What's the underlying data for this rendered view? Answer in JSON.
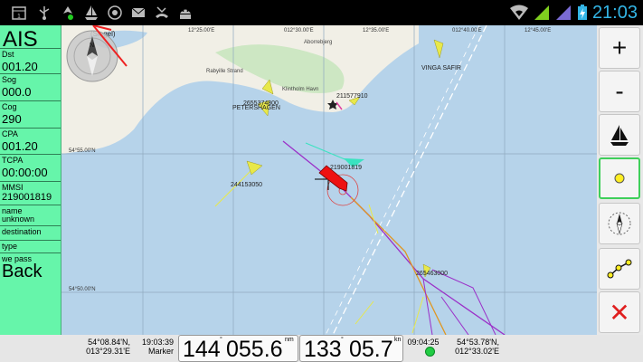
{
  "status_bar": {
    "time": "21:03",
    "icons": [
      "calendar-icon",
      "usb-icon",
      "nav-icon",
      "sailboat-icon",
      "disc-icon",
      "mail-icon",
      "missed-call-icon",
      "android-icon",
      "wifi-icon",
      "signal-icon",
      "signal-icon",
      "battery-charging-icon"
    ]
  },
  "left_panel": {
    "title": "AIS",
    "fields": [
      {
        "label": "Dst",
        "value": "001.20"
      },
      {
        "label": "Sog",
        "value": "000.0"
      },
      {
        "label": "Cog",
        "value": "290"
      },
      {
        "label": "CPA",
        "value": "001.20"
      },
      {
        "label": "TCPA",
        "value": "00:00:00"
      },
      {
        "label": "MMSI",
        "value": "219001819"
      },
      {
        "label": "name",
        "value": "unknown"
      },
      {
        "label": "destination",
        "value": ""
      },
      {
        "label": "type",
        "value": ""
      },
      {
        "label": "we pass",
        "value": ""
      }
    ],
    "back_label": "Back"
  },
  "map": {
    "grid_labels_top": [
      "12°25.00'E",
      "012°30.00'E",
      "12°35.00'E",
      "012°40.00'E",
      "12°45.00'E"
    ],
    "grid_labels_left": [
      "54°55.00'N",
      "54°50.00'N"
    ],
    "place_labels": [
      "Rabyille Strand",
      "Klintholm Havn",
      "Aborrebjerg",
      "(Siegel)"
    ],
    "vessel_labels": [
      "2655374800",
      "PETERSHAGEN",
      "211577910",
      "VINGA SAFIR",
      "219001819",
      "244153050",
      "265463000"
    ]
  },
  "toolbar": {
    "buttons": [
      {
        "name": "zoom-in-button",
        "glyph": "+"
      },
      {
        "name": "zoom-out-button",
        "glyph": "-"
      },
      {
        "name": "sailboat-button",
        "glyph": ""
      },
      {
        "name": "waypoint-button",
        "glyph": ""
      },
      {
        "name": "compass-button",
        "glyph": ""
      },
      {
        "name": "route-button",
        "glyph": ""
      },
      {
        "name": "close-button",
        "glyph": "✕"
      }
    ]
  },
  "bottom_bar": {
    "pos_left_lat": "54°08.84'N,",
    "pos_left_lon": "013°29.31'E",
    "marker_time": "19:03:39",
    "marker_label": "Marker",
    "bearing1": "144",
    "bearing1_unit": "°",
    "distance": "055.6",
    "distance_unit": "nm",
    "bearing2": "133",
    "bearing2_unit": "°",
    "speed": "05.7",
    "speed_unit": "kn",
    "eta_time": "09:04:25",
    "pos_right_lat": "54°53.78'N,",
    "pos_right_lon": "012°33.02'E"
  }
}
